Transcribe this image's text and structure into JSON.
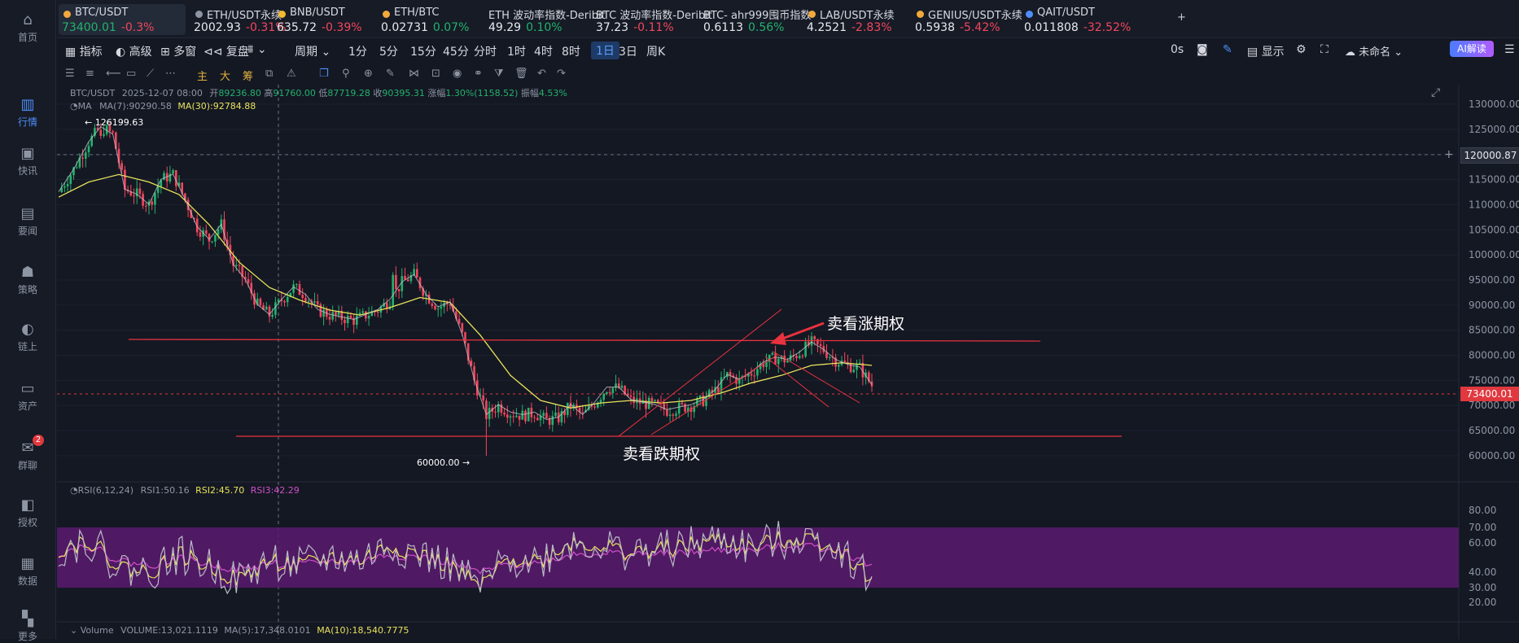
{
  "nav": [
    {
      "label": "首页",
      "icon": "home-icon"
    },
    {
      "label": "行情",
      "icon": "bar-chart-icon"
    },
    {
      "label": "快讯",
      "icon": "news-flash-icon"
    },
    {
      "label": "要闻",
      "icon": "document-icon"
    },
    {
      "label": "策略",
      "icon": "robot-icon"
    },
    {
      "label": "链上",
      "icon": "chain-icon"
    },
    {
      "label": "资产",
      "icon": "wallet-icon"
    },
    {
      "label": "群聊",
      "icon": "chat-icon",
      "badge": "2"
    },
    {
      "label": "授权",
      "icon": "authorize-icon"
    },
    {
      "label": "数据",
      "icon": "data-icon"
    },
    {
      "label": "更多",
      "icon": "grid-icon"
    }
  ],
  "tabs": [
    {
      "name": "BTC/USDT",
      "price": "73400.01",
      "change": "-0.3%",
      "dir": "dn",
      "dot": "#f2a93b"
    },
    {
      "name": "ETH/USDT永续",
      "price": "2002.93",
      "change": "-0.31%",
      "dir": "dn",
      "dot": "#8e95a3"
    },
    {
      "name": "BNB/USDT",
      "price": "635.72",
      "change": "-0.39%",
      "dir": "dn",
      "dot": "#f3ba2f"
    },
    {
      "name": "ETH/BTC",
      "price": "0.02731",
      "change": "0.07%",
      "dir": "up",
      "dot": "#f2a93b"
    },
    {
      "name": "ETH 波动率指数-Deribit",
      "price": "49.29",
      "change": "0.10%",
      "dir": "up",
      "dot": ""
    },
    {
      "name": "BTC 波动率指数-Deribit",
      "price": "37.23",
      "change": "-0.11%",
      "dir": "dn",
      "dot": ""
    },
    {
      "name": "BTC- ahr999囤币指数",
      "price": "0.6113",
      "change": "0.56%",
      "dir": "up",
      "dot": ""
    },
    {
      "name": "LAB/USDT永续",
      "price": "4.2521",
      "change": "-2.83%",
      "dir": "dn",
      "dot": "#f2a93b"
    },
    {
      "name": "GENIUS/USDT永续",
      "price": "0.5938",
      "change": "-5.42%",
      "dir": "dn",
      "dot": "#f2a93b"
    },
    {
      "name": "QAIT/USDT",
      "price": "0.011808",
      "change": "-32.52%",
      "dir": "dn",
      "dot": "#4e8ef7"
    }
  ],
  "toolbar": {
    "indicator": "指标",
    "advanced": "高级",
    "multi": "多窗",
    "replay": "复盘",
    "period": "周期",
    "intervals": [
      "1分",
      "5分",
      "15分",
      "45分",
      "分时",
      "1时",
      "4时",
      "8时",
      "1日",
      "3日",
      "周K"
    ],
    "active_interval": "1日",
    "countdown": "0s",
    "display": "显示",
    "unnamed": "未命名",
    "ai": "AI解读"
  },
  "drawing_tools": {
    "main": "主",
    "large": "大",
    "chips": "筹"
  },
  "legend": {
    "symbol": "BTC/USDT",
    "date": "2025-12-07 08:00",
    "open_label": "开",
    "open": "89236.80",
    "high_label": "高",
    "high": "91760.00",
    "low_label": "低",
    "low": "87719.28",
    "close_label": "收",
    "close": "90395.31",
    "chg_label": "涨幅",
    "chg": "1.30%(1158.52)",
    "amp_label": "振幅",
    "amp": "4.53%",
    "ma_label": "MA",
    "ma7": "MA(7):90290.58",
    "ma30": "MA(30):92784.88"
  },
  "rsi_legend": {
    "label": "RSI(6,12,24)",
    "rsi1": "RSI1:50.16",
    "rsi2": "RSI2:45.70",
    "rsi3": "RSI3:42.29"
  },
  "vol_legend": {
    "label": "Volume",
    "vol": "VOLUME:13,021.1119",
    "ma5": "MA(5):17,348.0101",
    "ma10": "MA(10):18,540.7775"
  },
  "annotations": {
    "sell_call": "卖看涨期权",
    "sell_put": "卖看跌期权",
    "high_marker": "126199.63",
    "low_marker": "60000.00"
  },
  "price_axis": [
    "130000.00",
    "125000.00",
    "120000.00",
    "115000.00",
    "110000.00",
    "105000.00",
    "100000.00",
    "95000.00",
    "90000.00",
    "85000.00",
    "80000.00",
    "75000.00",
    "70000.00",
    "65000.00",
    "60000.00"
  ],
  "rsi_axis": [
    "80.00",
    "70.00",
    "60.00",
    "40.00",
    "30.00",
    "20.00"
  ],
  "crosshair_price": "120000.87",
  "last_price": "73400.01",
  "colors": {
    "up": "#23b26d",
    "down": "#f4465d",
    "ma30": "#e8e25a",
    "ma7": "#c6c9d2",
    "rsi2": "#e8e25a",
    "rsi3": "#d14fc9",
    "rsi1": "#b8bcc8",
    "annotation_line": "#e8323e",
    "rsi_band": "#5b1a6e"
  },
  "chart_data": {
    "type": "candlestick",
    "timeframe": "1日",
    "last": 73400.01,
    "high": 126199.63,
    "low": 60000.0,
    "support": 65000,
    "resistance": 84000,
    "close_path": [
      [
        0,
        112500
      ],
      [
        5,
        117000
      ],
      [
        10,
        122500
      ],
      [
        14,
        125500
      ],
      [
        18,
        124000
      ],
      [
        22,
        113000
      ],
      [
        26,
        112000
      ],
      [
        30,
        110000
      ],
      [
        34,
        115000
      ],
      [
        38,
        116000
      ],
      [
        42,
        111000
      ],
      [
        46,
        105500
      ],
      [
        50,
        103000
      ],
      [
        54,
        106000
      ],
      [
        58,
        98000
      ],
      [
        62,
        95000
      ],
      [
        66,
        90000
      ],
      [
        70,
        88000
      ],
      [
        74,
        91000
      ],
      [
        78,
        93500
      ],
      [
        82,
        92000
      ],
      [
        86,
        89000
      ],
      [
        90,
        88000
      ],
      [
        94,
        87500
      ],
      [
        98,
        87000
      ],
      [
        102,
        88000
      ],
      [
        106,
        89000
      ],
      [
        110,
        91000
      ],
      [
        114,
        94500
      ],
      [
        118,
        96000
      ],
      [
        122,
        92000
      ],
      [
        126,
        89500
      ],
      [
        130,
        90500
      ],
      [
        134,
        84000
      ],
      [
        138,
        75000
      ],
      [
        142,
        68000
      ],
      [
        146,
        70000
      ],
      [
        150,
        68500
      ],
      [
        154,
        68000
      ],
      [
        158,
        68500
      ],
      [
        162,
        67000
      ],
      [
        166,
        67500
      ],
      [
        170,
        70000
      ],
      [
        174,
        68000
      ],
      [
        178,
        70500
      ],
      [
        182,
        73500
      ],
      [
        186,
        73500
      ],
      [
        190,
        71000
      ],
      [
        194,
        70500
      ],
      [
        198,
        70000
      ],
      [
        202,
        69000
      ],
      [
        206,
        69500
      ],
      [
        210,
        70000
      ],
      [
        214,
        71000
      ],
      [
        218,
        73000
      ],
      [
        222,
        76000
      ],
      [
        226,
        75000
      ],
      [
        230,
        76500
      ],
      [
        234,
        78500
      ],
      [
        238,
        79500
      ],
      [
        242,
        79000
      ],
      [
        246,
        80500
      ],
      [
        250,
        82500
      ],
      [
        254,
        81000
      ],
      [
        258,
        79000
      ],
      [
        262,
        78000
      ],
      [
        266,
        77500
      ],
      [
        270,
        74000
      ]
    ],
    "ma30_path": [
      [
        0,
        111500
      ],
      [
        10,
        114500
      ],
      [
        20,
        116000
      ],
      [
        30,
        114500
      ],
      [
        40,
        112000
      ],
      [
        50,
        106000
      ],
      [
        60,
        98500
      ],
      [
        70,
        93500
      ],
      [
        80,
        91000
      ],
      [
        90,
        89000
      ],
      [
        100,
        88000
      ],
      [
        110,
        89500
      ],
      [
        120,
        91500
      ],
      [
        130,
        90500
      ],
      [
        140,
        84000
      ],
      [
        150,
        76000
      ],
      [
        160,
        71000
      ],
      [
        170,
        69500
      ],
      [
        180,
        70500
      ],
      [
        190,
        71000
      ],
      [
        200,
        70500
      ],
      [
        210,
        71000
      ],
      [
        220,
        72500
      ],
      [
        230,
        74500
      ],
      [
        240,
        76000
      ],
      [
        250,
        78000
      ],
      [
        260,
        78500
      ],
      [
        270,
        78000
      ]
    ],
    "rsi2_path": [
      [
        0,
        55
      ],
      [
        10,
        62
      ],
      [
        20,
        44
      ],
      [
        30,
        40
      ],
      [
        40,
        52
      ],
      [
        50,
        44
      ],
      [
        60,
        35
      ],
      [
        70,
        48
      ],
      [
        80,
        44
      ],
      [
        90,
        50
      ],
      [
        100,
        48
      ],
      [
        110,
        58
      ],
      [
        120,
        52
      ],
      [
        130,
        44
      ],
      [
        140,
        30
      ],
      [
        150,
        50
      ],
      [
        160,
        48
      ],
      [
        170,
        60
      ],
      [
        180,
        58
      ],
      [
        190,
        53
      ],
      [
        200,
        55
      ],
      [
        210,
        58
      ],
      [
        220,
        62
      ],
      [
        230,
        56
      ],
      [
        240,
        62
      ],
      [
        250,
        63
      ],
      [
        260,
        55
      ],
      [
        270,
        35
      ]
    ],
    "rsi3_path": [
      [
        0,
        53
      ],
      [
        10,
        58
      ],
      [
        20,
        48
      ],
      [
        30,
        45
      ],
      [
        40,
        49
      ],
      [
        50,
        46
      ],
      [
        60,
        42
      ],
      [
        70,
        46
      ],
      [
        80,
        45
      ],
      [
        90,
        47
      ],
      [
        100,
        47
      ],
      [
        110,
        52
      ],
      [
        120,
        50
      ],
      [
        130,
        47
      ],
      [
        140,
        40
      ],
      [
        150,
        46
      ],
      [
        160,
        46
      ],
      [
        170,
        52
      ],
      [
        180,
        53
      ],
      [
        190,
        52
      ],
      [
        200,
        52
      ],
      [
        210,
        53
      ],
      [
        220,
        55
      ],
      [
        230,
        54
      ],
      [
        240,
        57
      ],
      [
        250,
        58
      ],
      [
        260,
        54
      ],
      [
        270,
        45
      ]
    ]
  }
}
